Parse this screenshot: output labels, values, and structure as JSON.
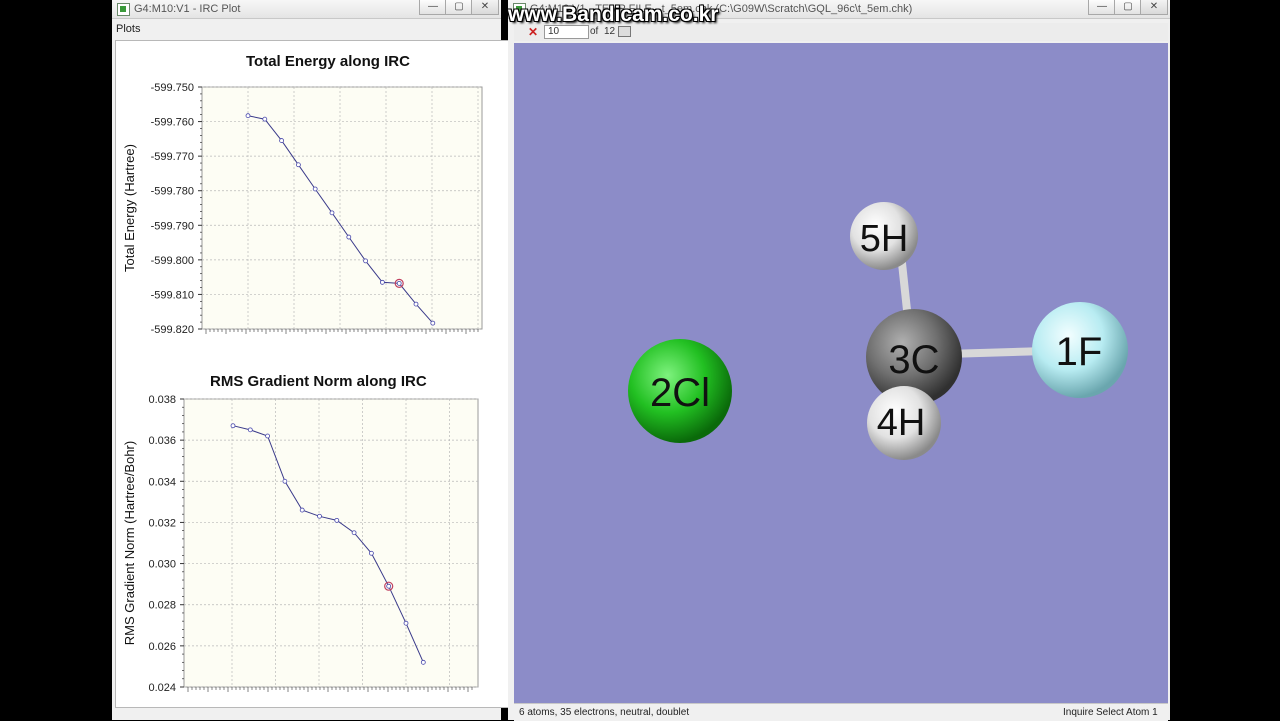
{
  "left_window": {
    "title": "G4:M10:V1 - IRC Plot",
    "menu_label": "Plots",
    "buttons": {
      "minimize": "—",
      "restore": "▢",
      "close": "✕"
    }
  },
  "right_window": {
    "title": "G4:M10:V1 - TEMP FILE - t_5em.chk (C:\\G09W\\Scratch\\GQL_96c\\t_5em.chk)",
    "frame_value": "10",
    "frame_of_label": "of",
    "frame_total": "12",
    "status_left": "6 atoms, 35 electrons, neutral, doublet",
    "status_mode": "Inquire",
    "status_right": "Select Atom 1",
    "buttons": {
      "minimize": "—",
      "restore": "▢",
      "close": "✕"
    }
  },
  "watermark": "www.Bandicam.co.kr",
  "molecule": {
    "background": "#8c8cc8",
    "atoms": [
      {
        "label": "1F",
        "color": "#b8ecf2"
      },
      {
        "label": "2Cl",
        "color": "#22c022"
      },
      {
        "label": "3C",
        "color": "#707070"
      },
      {
        "label": "4H",
        "color": "#e8e8e8"
      },
      {
        "label": "5H",
        "color": "#e8e8e8"
      }
    ]
  },
  "chart_data": [
    {
      "type": "line",
      "title": "Total Energy along IRC",
      "ylabel": "Total Energy (Hartree)",
      "xlabel": "",
      "ylim": [
        -599.82,
        -599.75
      ],
      "yticks": [
        "-599.750",
        "-599.760",
        "-599.770",
        "-599.780",
        "-599.790",
        "-599.800",
        "-599.810",
        "-599.820"
      ],
      "grid": true,
      "x": [
        1,
        2,
        3,
        4,
        5,
        6,
        7,
        8,
        9,
        10,
        11,
        12
      ],
      "values": [
        -599.7583,
        -599.7593,
        -599.7655,
        -599.7725,
        -599.7795,
        -599.7864,
        -599.7934,
        -599.8003,
        -599.8065,
        -599.8068,
        -599.8128,
        -599.8183
      ],
      "current_point": 10
    },
    {
      "type": "line",
      "title": "RMS Gradient Norm along IRC",
      "ylabel": "RMS Gradient Norm (Hartree/Bohr)",
      "xlabel": "",
      "ylim": [
        0.024,
        0.038
      ],
      "yticks": [
        "0.038",
        "0.036",
        "0.034",
        "0.032",
        "0.030",
        "0.028",
        "0.026",
        "0.024"
      ],
      "grid": true,
      "x": [
        1,
        2,
        3,
        4,
        5,
        6,
        7,
        8,
        9,
        10,
        11,
        12
      ],
      "values": [
        0.0367,
        0.0365,
        0.0362,
        0.034,
        0.0326,
        0.0323,
        0.0321,
        0.0315,
        0.0305,
        0.0289,
        0.0271,
        0.0252
      ],
      "current_point": 10
    }
  ]
}
